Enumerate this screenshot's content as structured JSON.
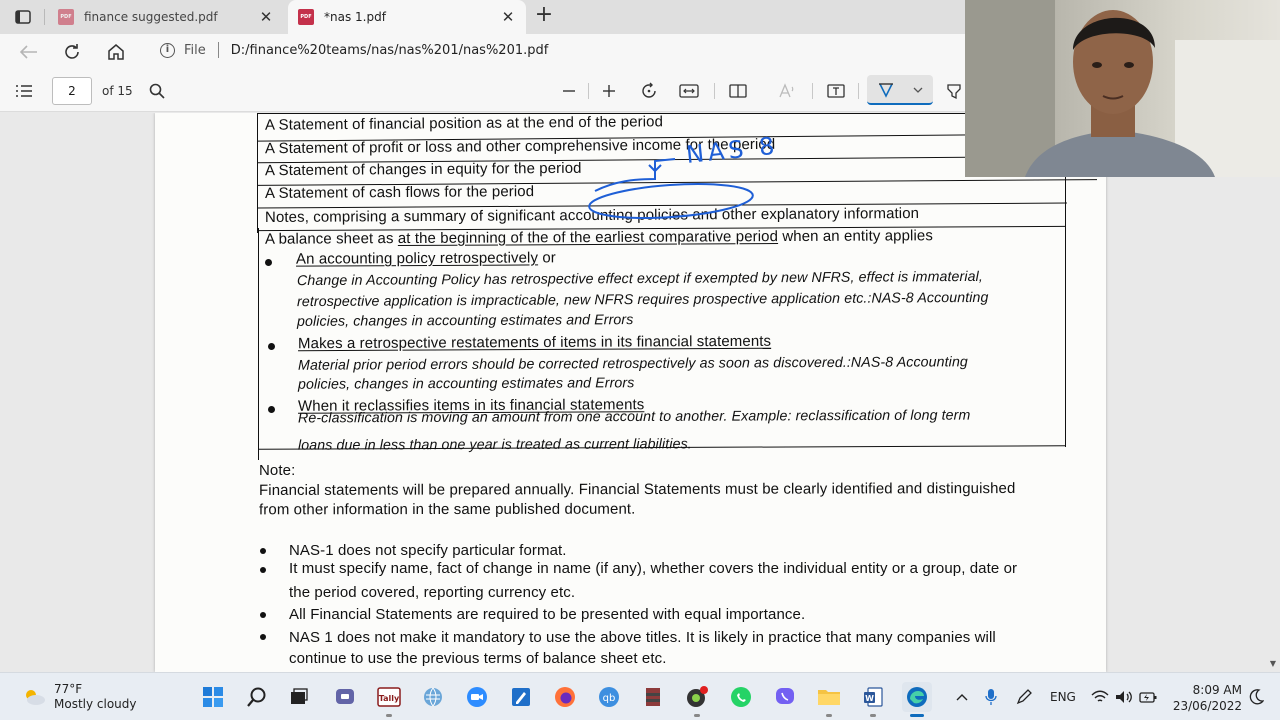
{
  "tabs": [
    {
      "title": "finance suggested.pdf",
      "active": false
    },
    {
      "title": "*nas 1.pdf",
      "active": true
    }
  ],
  "address": {
    "info_label": "File",
    "url": "D:/finance%20teams/nas/nas%201/nas%201.pdf"
  },
  "pdf_toolbar": {
    "current_page": "2",
    "page_count_label": "of 15"
  },
  "document": {
    "table_rows": [
      "A Statement of financial position as at the end of the period",
      "A Statement of profit or loss and other comprehensive income for the period",
      "A Statement of changes in equity for the period",
      "A Statement of cash flows for the period",
      "Notes, comprising a summary of significant accounting policies and other explanatory information"
    ],
    "balance_sheet_intro_prefix": "A balance sheet as ",
    "balance_sheet_intro_underlined": "at the beginning of the of the earliest comparative period",
    "balance_sheet_intro_suffix": " when an entity applies",
    "handwritten_note": "NAS 8",
    "bullet1_title": "An accounting policy retrospectively",
    "bullet1_or": " or",
    "bullet1_italic": [
      "Change in Accounting Policy has retrospective effect except if exempted by new NFRS, effect is immaterial,",
      "retrospective application is impracticable, new NFRS requires prospective application etc.:NAS-8 Accounting",
      "policies, changes in accounting estimates and Errors"
    ],
    "bullet2_title": "Makes a retrospective restatements of items in its financial statements",
    "bullet2_italic": [
      "Material prior period errors should be corrected retrospectively as soon as discovered.:NAS-8 Accounting",
      "policies, changes in accounting estimates and Errors"
    ],
    "bullet3_title": "When it reclassifies items in its financial statements",
    "bullet3_italic": [
      "Re-classification is moving an amount from one account to another. Example: reclassification of long term",
      "loans due in less than one year is treated as current liabilities."
    ],
    "note_heading": "Note:",
    "note_lines": [
      "Financial statements will be prepared annually. Financial Statements must be clearly identified and distinguished",
      "from other information in the same published document."
    ],
    "points": [
      "NAS-1 does not specify particular format.",
      "It must specify name, fact of change in name (if any), whether covers the individual entity or a group, date or",
      "the period covered, reporting currency etc.",
      "All Financial Statements are required to be presented with equal importance.",
      "NAS 1 does not make it mandatory to use the above titles. It is likely in practice that many companies will",
      "continue to use the previous terms of balance sheet etc."
    ]
  },
  "taskbar": {
    "weather_temp": "77°F",
    "weather_desc": "Mostly cloudy",
    "language": "ENG",
    "time": "8:09 AM",
    "date": "23/06/2022"
  },
  "colors": {
    "pen_blue": "#1f5fd6",
    "edge_accent": "#0f6cbd",
    "pdf_red": "#c4314b"
  }
}
